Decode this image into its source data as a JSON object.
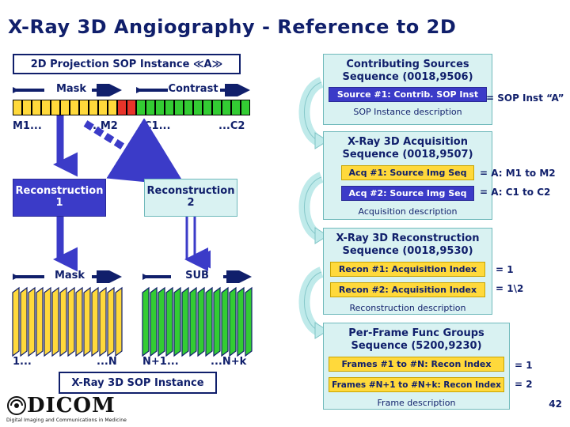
{
  "title": "X-Ray 3D Angiography - Reference to 2D",
  "left": {
    "projection_header": "2D Projection SOP Instance ≪A≫",
    "mask_label": "Mask",
    "contrast_label": "Contrast",
    "m1_label": "M1...",
    "m2_label": "...M2",
    "c1_label": "C1...",
    "c2_label": "...C2",
    "reconstruction_1": "Reconstruction\n1",
    "reconstruction_1_line1": "Reconstruction",
    "reconstruction_1_line2": "1",
    "reconstruction_2_line1": "Reconstruction",
    "reconstruction_2_line2": "2",
    "mask_label_2": "Mask",
    "sub_label": "SUB",
    "n_start": "1...",
    "n_end": "...N",
    "nk_start": "N+1...",
    "nk_end": "...N+k",
    "footer_box": "X-Ray 3D SOP Instance"
  },
  "panels": [
    {
      "title_line1": "Contributing Sources",
      "title_line2": "Sequence (0018,9506)",
      "rows": [
        {
          "bar": "Source #1: Contrib. SOP Inst",
          "eq": "= SOP Inst “A”",
          "style": "blue"
        }
      ],
      "desc": "SOP Instance description"
    },
    {
      "title_line1": "X-Ray 3D Acquisition",
      "title_line2": "Sequence (0018,9507)",
      "rows": [
        {
          "bar": "Acq #1: Source Img Seq",
          "eq": "= A: M1 to M2",
          "style": "yellow"
        },
        {
          "bar": "Acq #2: Source Img Seq",
          "eq": "= A: C1 to C2",
          "style": "yellow"
        }
      ],
      "desc": "Acquisition description"
    },
    {
      "title_line1": "X-Ray 3D Reconstruction",
      "title_line2": "Sequence (0018,9530)",
      "rows": [
        {
          "bar": "Recon #1: Acquisition Index",
          "eq": "= 1",
          "style": "yellow"
        },
        {
          "bar": "Recon #2: Acquisition Index",
          "eq": "= 1\\2",
          "style": "yellow"
        }
      ],
      "desc": "Reconstruction description"
    },
    {
      "title_line1": "Per-Frame Func Groups",
      "title_line2": "Sequence (5200,9230)",
      "rows": [
        {
          "bar": "Frames #1 to #N: Recon Index",
          "eq": "= 1",
          "style": "yellow"
        },
        {
          "bar": "Frames #N+1 to #N+k: Recon Index",
          "eq": "= 2",
          "style": "yellow"
        }
      ],
      "desc": "Frame description"
    }
  ],
  "logo": {
    "name": "DICOM",
    "tagline": "Digital Imaging and Communications in Medicine"
  },
  "page_number": "42",
  "colors": {
    "navy": "#101f6b",
    "panel_bg": "#d9f2f2",
    "yellow": "#ffd93b",
    "blue": "#3b3bc8",
    "green": "#33cc33"
  }
}
